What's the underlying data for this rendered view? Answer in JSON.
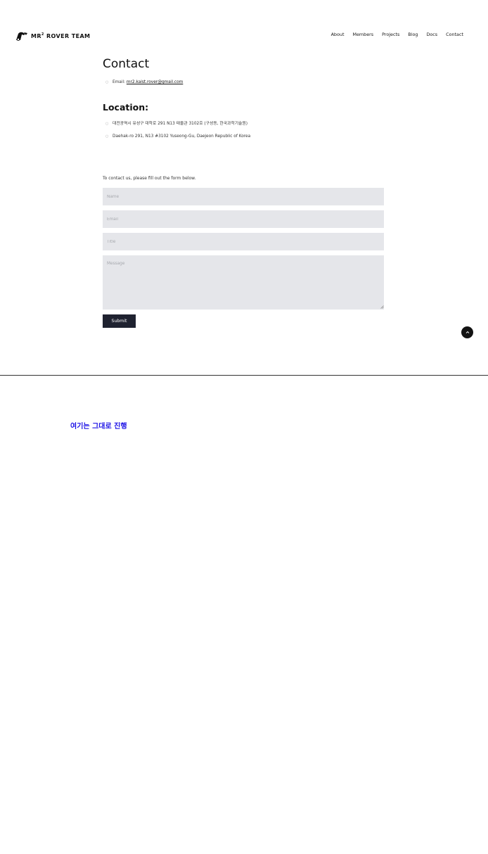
{
  "header": {
    "logo_text": "MR",
    "logo_sup": "2",
    "logo_text_tail": " ROVER TEAM",
    "nav": [
      "About",
      "Members",
      "Projects",
      "Blog",
      "Docs",
      "Contact"
    ]
  },
  "contact": {
    "title": "Contact",
    "email_label": "Email: ",
    "email_value": "mr2.kaist.rover@gmail.com"
  },
  "location": {
    "title": "Location:",
    "lines": [
      "대전광역시 유성구 대학로 291 N13 태울관 3102호 (구성동, 한국과학기술원)",
      "Daehak-ro 291, N13 #3102 Yuseong-Gu, Daejeon Republic of Korea"
    ]
  },
  "form": {
    "intro": "To contact us, please fill out the form below.",
    "name_placeholder": "Name",
    "email_placeholder": "Email",
    "title_placeholder": "Title",
    "message_placeholder": "Message",
    "submit_label": "Submit"
  },
  "note": "여기는 그대로 진행",
  "colors": {
    "accent_note": "#1f14e6",
    "button_bg": "#1f2230",
    "field_bg": "#e5e6ea"
  },
  "icons": [
    "rover-logo-icon",
    "chevron-up-icon",
    "resize-grip-icon"
  ]
}
